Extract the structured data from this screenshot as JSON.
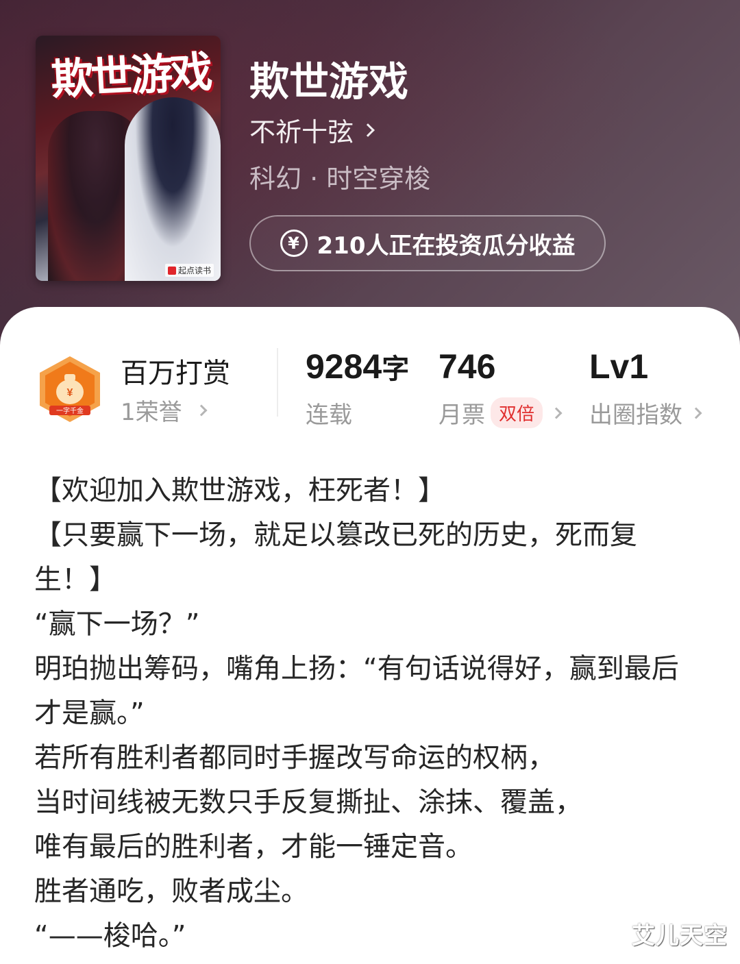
{
  "book": {
    "cover_title": "欺世游戏",
    "cover_badge": "起点读书",
    "title": "欺世游戏",
    "author": "不祈十弦",
    "genre": "科幻 · 时空穿梭",
    "invest_label": "210人正在投资瓜分收益",
    "invest_icon": "yen-icon"
  },
  "award": {
    "icon": "money-bag-award-icon",
    "icon_caption": "一字千金",
    "title": "百万打赏",
    "subtitle": "1荣誉"
  },
  "stats": {
    "words_value": "9284",
    "words_unit": "字",
    "words_label": "连载",
    "monthly_value": "746",
    "monthly_label": "月票",
    "monthly_badge": "双倍",
    "level_value": "Lv1",
    "level_label": "出圈指数"
  },
  "synopsis": [
    "【欢迎加入欺世游戏，枉死者！】",
    "【只要赢下一场，就足以篡改已死的历史，死而复生！】",
    "“赢下一场？”",
    "明珀抛出筹码，嘴角上扬：“有句话说得好，赢到最后才是赢。”",
    "若所有胜利者都同时手握改写命运的权柄，",
    "当时间线被无数只手反复撕扯、涂抹、覆盖，",
    "唯有最后的胜利者，才能一锤定音。",
    "胜者通吃，败者成尘。",
    "“——梭哈。”"
  ],
  "watermark": "艾儿天空",
  "colors": {
    "accent_red": "#e02e2e",
    "award_orange": "#f07a1a",
    "hero_bg": "#4a3040"
  }
}
